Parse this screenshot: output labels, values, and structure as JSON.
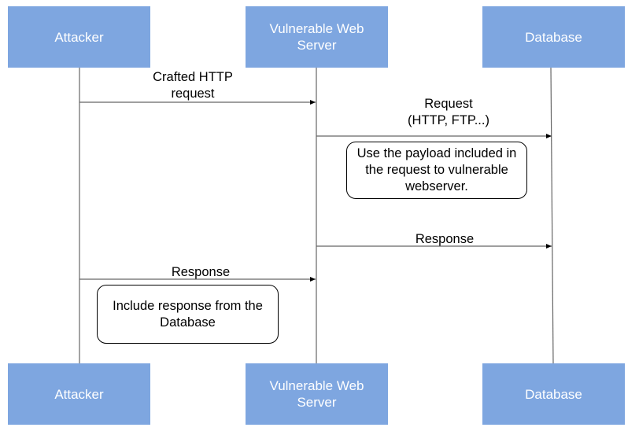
{
  "colors": {
    "actor_fill": "#7EA6E0",
    "actor_text": "#FFFFFF",
    "line": "#666666",
    "arrow_head": "#000000",
    "background": "#FFFFFF"
  },
  "actors": [
    {
      "id": "attacker",
      "label": "Attacker"
    },
    {
      "id": "server",
      "label": "Vulnerable Web Server"
    },
    {
      "id": "database",
      "label": "Database"
    }
  ],
  "messages": [
    {
      "from": "attacker",
      "to": "server",
      "label": "Crafted HTTP\nrequest",
      "direction": "right"
    },
    {
      "from": "server",
      "to": "database",
      "label": "Request\n(HTTP, FTP...)",
      "direction": "right"
    },
    {
      "from": "server",
      "to": "database",
      "label": "Response",
      "direction": "right"
    },
    {
      "from": "attacker",
      "to": "server",
      "label": "Response",
      "direction": "right"
    }
  ],
  "notes": [
    {
      "text": "Use the payload included in the request to vulnerable webserver."
    },
    {
      "text": "Include response from the Database"
    }
  ]
}
